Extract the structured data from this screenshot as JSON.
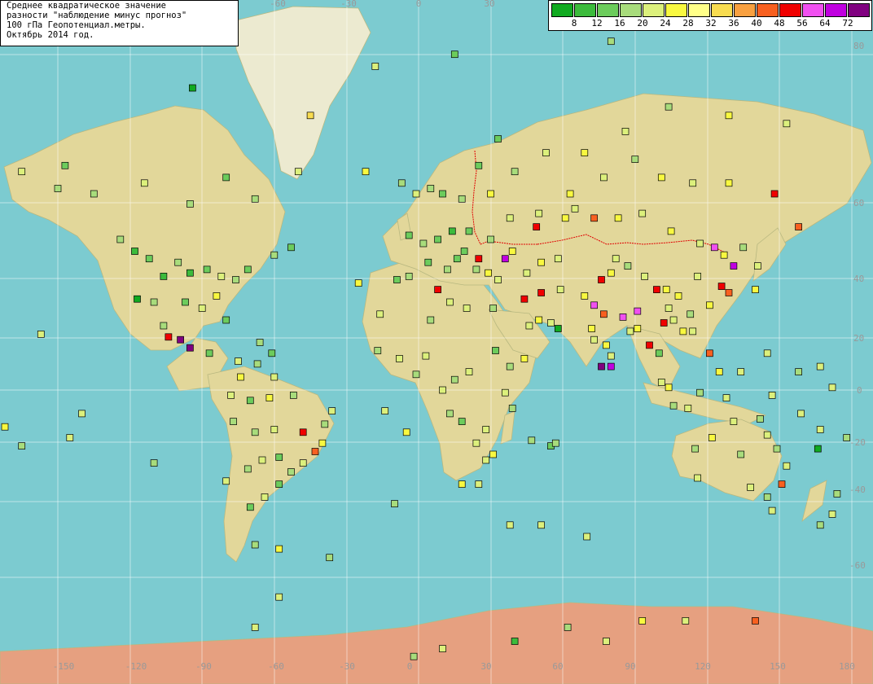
{
  "title": {
    "lines": [
      "Среднее квадратическое значение",
      "разности \"наблюдение минус прогноз\"",
      "100 гПа Геопотенциал.метры.",
      "Октябрь 2014 год."
    ]
  },
  "legend": {
    "colors": [
      "#10aa20",
      "#3cbb3c",
      "#6ccc5c",
      "#a8dc7c",
      "#dcf07c",
      "#f8f840",
      "#ffff88",
      "#f8dc50",
      "#f8a040",
      "#f86020",
      "#f00000",
      "#f050f0",
      "#c000e0",
      "#800080"
    ],
    "labels": [
      "8",
      "12",
      "16",
      "20",
      "24",
      "28",
      "32",
      "36",
      "40",
      "48",
      "56",
      "64",
      "72"
    ]
  },
  "axes": {
    "lon_labels": [
      "-150",
      "-120",
      "-90",
      "-60",
      "-30",
      "0",
      "30",
      "60",
      "90",
      "120",
      "150",
      "180"
    ],
    "lat_labels": [
      "80",
      "60",
      "40",
      "20",
      "0",
      "-20",
      "-40",
      "-60"
    ],
    "top_lon_labels": [
      "-60",
      "-30",
      "0",
      "30"
    ]
  },
  "stations": [
    {
      "lon": -124,
      "lat": 50,
      "c": 3
    },
    {
      "lon": -118,
      "lat": 47,
      "c": 1
    },
    {
      "lon": -112,
      "lat": 45,
      "c": 2
    },
    {
      "lon": -106,
      "lat": 40,
      "c": 1
    },
    {
      "lon": -100,
      "lat": 44,
      "c": 3
    },
    {
      "lon": -95,
      "lat": 41,
      "c": 1
    },
    {
      "lon": -88,
      "lat": 42,
      "c": 2
    },
    {
      "lon": -82,
      "lat": 40,
      "c": 4
    },
    {
      "lon": -76,
      "lat": 39,
      "c": 3
    },
    {
      "lon": -71,
      "lat": 42,
      "c": 2
    },
    {
      "lon": -90,
      "lat": 30,
      "c": 4
    },
    {
      "lon": -97,
      "lat": 32,
      "c": 2
    },
    {
      "lon": -84,
      "lat": 34,
      "c": 5
    },
    {
      "lon": -80,
      "lat": 26,
      "c": 2
    },
    {
      "lon": -110,
      "lat": 32,
      "c": 3
    },
    {
      "lon": -117,
      "lat": 33,
      "c": 0
    },
    {
      "lon": -104,
      "lat": 20,
      "c": 10
    },
    {
      "lon": -99,
      "lat": 19,
      "c": 13
    },
    {
      "lon": -95,
      "lat": 16,
      "c": 13
    },
    {
      "lon": -87,
      "lat": 14,
      "c": 2
    },
    {
      "lon": -106,
      "lat": 24,
      "c": 3
    },
    {
      "lon": -150,
      "lat": 61,
      "c": 3
    },
    {
      "lon": -165,
      "lat": 64,
      "c": 4
    },
    {
      "lon": -147,
      "lat": 65,
      "c": 2
    },
    {
      "lon": -135,
      "lat": 60,
      "c": 3
    },
    {
      "lon": -114,
      "lat": 62,
      "c": 4
    },
    {
      "lon": -95,
      "lat": 58,
      "c": 3
    },
    {
      "lon": -80,
      "lat": 63,
      "c": 2
    },
    {
      "lon": -68,
      "lat": 59,
      "c": 3
    },
    {
      "lon": -94,
      "lat": 75,
      "c": 0
    },
    {
      "lon": -62,
      "lat": 82,
      "c": 0
    },
    {
      "lon": -45,
      "lat": 72,
      "c": 7
    },
    {
      "lon": -50,
      "lat": 64,
      "c": 4
    },
    {
      "lon": -22,
      "lat": 64,
      "c": 5
    },
    {
      "lon": -18,
      "lat": 77,
      "c": 4
    },
    {
      "lon": -60,
      "lat": 46,
      "c": 3
    },
    {
      "lon": -53,
      "lat": 48,
      "c": 2
    },
    {
      "lon": -66,
      "lat": 18,
      "c": 3
    },
    {
      "lon": -61,
      "lat": 14,
      "c": 2
    },
    {
      "lon": -75,
      "lat": 11,
      "c": 4
    },
    {
      "lon": -74,
      "lat": 5,
      "c": 5
    },
    {
      "lon": -67,
      "lat": 10,
      "c": 3
    },
    {
      "lon": -60,
      "lat": 5,
      "c": 4
    },
    {
      "lon": -52,
      "lat": -2,
      "c": 3
    },
    {
      "lon": -62,
      "lat": -3,
      "c": 5
    },
    {
      "lon": -70,
      "lat": -4,
      "c": 2
    },
    {
      "lon": -78,
      "lat": -2,
      "c": 4
    },
    {
      "lon": -77,
      "lat": -12,
      "c": 3
    },
    {
      "lon": -68,
      "lat": -16,
      "c": 3
    },
    {
      "lon": -60,
      "lat": -15,
      "c": 4
    },
    {
      "lon": -48,
      "lat": -16,
      "c": 10
    },
    {
      "lon": -43,
      "lat": -23,
      "c": 9
    },
    {
      "lon": -39,
      "lat": -13,
      "c": 3
    },
    {
      "lon": -36,
      "lat": -8,
      "c": 4
    },
    {
      "lon": -58,
      "lat": -25,
      "c": 2
    },
    {
      "lon": -65,
      "lat": -26,
      "c": 4
    },
    {
      "lon": -71,
      "lat": -29,
      "c": 3
    },
    {
      "lon": -58,
      "lat": -34,
      "c": 2
    },
    {
      "lon": -64,
      "lat": -38,
      "c": 4
    },
    {
      "lon": -70,
      "lat": -41,
      "c": 2
    },
    {
      "lon": -68,
      "lat": -51,
      "c": 3
    },
    {
      "lon": -58,
      "lat": -52,
      "c": 5
    },
    {
      "lon": -48,
      "lat": -27,
      "c": 4
    },
    {
      "lon": -53,
      "lat": -30,
      "c": 3
    },
    {
      "lon": -40,
      "lat": -20,
      "c": 5
    },
    {
      "lon": -14,
      "lat": -8,
      "c": 4
    },
    {
      "lon": -5,
      "lat": -16,
      "c": 5
    },
    {
      "lon": -25,
      "lat": 38,
      "c": 5
    },
    {
      "lon": -16,
      "lat": 28,
      "c": 4
    },
    {
      "lon": -17,
      "lat": 15,
      "c": 3
    },
    {
      "lon": -8,
      "lat": 12,
      "c": 4
    },
    {
      "lon": -1,
      "lat": 6,
      "c": 3
    },
    {
      "lon": 3,
      "lat": 13,
      "c": 4
    },
    {
      "lon": 8,
      "lat": 36,
      "c": 10
    },
    {
      "lon": 13,
      "lat": 32,
      "c": 4
    },
    {
      "lon": 5,
      "lat": 26,
      "c": 3
    },
    {
      "lon": 20,
      "lat": 30,
      "c": 4
    },
    {
      "lon": 31,
      "lat": 30,
      "c": 3
    },
    {
      "lon": 32,
      "lat": 15,
      "c": 2
    },
    {
      "lon": 38,
      "lat": 9,
      "c": 3
    },
    {
      "lon": 36,
      "lat": -1,
      "c": 4
    },
    {
      "lon": 39,
      "lat": -7,
      "c": 3
    },
    {
      "lon": 28,
      "lat": -15,
      "c": 4
    },
    {
      "lon": 18,
      "lat": -12,
      "c": 2
    },
    {
      "lon": 13,
      "lat": -9,
      "c": 3
    },
    {
      "lon": 24,
      "lat": -20,
      "c": 4
    },
    {
      "lon": 31,
      "lat": -24,
      "c": 5
    },
    {
      "lon": 28,
      "lat": -26,
      "c": 4
    },
    {
      "lon": 18,
      "lat": -34,
      "c": 5
    },
    {
      "lon": 25,
      "lat": -34,
      "c": 4
    },
    {
      "lon": 47,
      "lat": -19,
      "c": 3
    },
    {
      "lon": 55,
      "lat": -21,
      "c": 2
    },
    {
      "lon": 57,
      "lat": -20,
      "c": 3
    },
    {
      "lon": 10,
      "lat": 0,
      "c": 4
    },
    {
      "lon": 15,
      "lat": 4,
      "c": 3
    },
    {
      "lon": 21,
      "lat": 7,
      "c": 4
    },
    {
      "lon": 44,
      "lat": 12,
      "c": 5
    },
    {
      "lon": 46,
      "lat": 24,
      "c": 4
    },
    {
      "lon": 50,
      "lat": 26,
      "c": 5
    },
    {
      "lon": 55,
      "lat": 25,
      "c": 4
    },
    {
      "lon": 58,
      "lat": 23,
      "c": 0
    },
    {
      "lon": 44,
      "lat": 33,
      "c": 10
    },
    {
      "lon": 51,
      "lat": 35,
      "c": 10
    },
    {
      "lon": 59,
      "lat": 36,
      "c": 4
    },
    {
      "lon": 69,
      "lat": 34,
      "c": 5
    },
    {
      "lon": 73,
      "lat": 31,
      "c": 11
    },
    {
      "lon": 77,
      "lat": 28,
      "c": 9
    },
    {
      "lon": 72,
      "lat": 23,
      "c": 5
    },
    {
      "lon": 73,
      "lat": 19,
      "c": 4
    },
    {
      "lon": 78,
      "lat": 17,
      "c": 5
    },
    {
      "lon": 80,
      "lat": 13,
      "c": 4
    },
    {
      "lon": 76,
      "lat": 9,
      "c": 13
    },
    {
      "lon": 80,
      "lat": 9,
      "c": 12
    },
    {
      "lon": 88,
      "lat": 22,
      "c": 4
    },
    {
      "lon": 85,
      "lat": 27,
      "c": 11
    },
    {
      "lon": 91,
      "lat": 23,
      "c": 5
    },
    {
      "lon": 96,
      "lat": 17,
      "c": 10
    },
    {
      "lon": 100,
      "lat": 14,
      "c": 2
    },
    {
      "lon": 101,
      "lat": 3,
      "c": 4
    },
    {
      "lon": 104,
      "lat": 1,
      "c": 5
    },
    {
      "lon": 106,
      "lat": -6,
      "c": 3
    },
    {
      "lon": 112,
      "lat": -7,
      "c": 4
    },
    {
      "lon": 117,
      "lat": -1,
      "c": 3
    },
    {
      "lon": 125,
      "lat": 7,
      "c": 5
    },
    {
      "lon": 121,
      "lat": 14,
      "c": 9
    },
    {
      "lon": 114,
      "lat": 22,
      "c": 4
    },
    {
      "lon": 113,
      "lat": 28,
      "c": 3
    },
    {
      "lon": 108,
      "lat": 34,
      "c": 5
    },
    {
      "lon": 116,
      "lat": 40,
      "c": 4
    },
    {
      "lon": 121,
      "lat": 31,
      "c": 5
    },
    {
      "lon": 126,
      "lat": 37,
      "c": 10
    },
    {
      "lon": 129,
      "lat": 35,
      "c": 9
    },
    {
      "lon": 140,
      "lat": 36,
      "c": 5
    },
    {
      "lon": 141,
      "lat": 43,
      "c": 4
    },
    {
      "lon": 131,
      "lat": 43,
      "c": 12
    },
    {
      "lon": 127,
      "lat": 46,
      "c": 5
    },
    {
      "lon": 123,
      "lat": 48,
      "c": 11
    },
    {
      "lon": 117,
      "lat": 49,
      "c": 4
    },
    {
      "lon": 105,
      "lat": 52,
      "c": 5
    },
    {
      "lon": 93,
      "lat": 56,
      "c": 4
    },
    {
      "lon": 83,
      "lat": 55,
      "c": 5
    },
    {
      "lon": 73,
      "lat": 55,
      "c": 9
    },
    {
      "lon": 65,
      "lat": 57,
      "c": 4
    },
    {
      "lon": 61,
      "lat": 55,
      "c": 5
    },
    {
      "lon": 50,
      "lat": 56,
      "c": 4
    },
    {
      "lon": 49,
      "lat": 53,
      "c": 10
    },
    {
      "lon": 38,
      "lat": 55,
      "c": 4
    },
    {
      "lon": 30,
      "lat": 60,
      "c": 5
    },
    {
      "lon": 40,
      "lat": 64,
      "c": 3
    },
    {
      "lon": 33,
      "lat": 69,
      "c": 2
    },
    {
      "lon": 53,
      "lat": 67,
      "c": 4
    },
    {
      "lon": 69,
      "lat": 67,
      "c": 5
    },
    {
      "lon": 86,
      "lat": 70,
      "c": 4
    },
    {
      "lon": 104,
      "lat": 73,
      "c": 3
    },
    {
      "lon": 129,
      "lat": 72,
      "c": 5
    },
    {
      "lon": 153,
      "lat": 71,
      "c": 4
    },
    {
      "lon": 148,
      "lat": 60,
      "c": 10
    },
    {
      "lon": 158,
      "lat": 53,
      "c": 9
    },
    {
      "lon": 135,
      "lat": 48,
      "c": 3
    },
    {
      "lon": 129,
      "lat": 62,
      "c": 5
    },
    {
      "lon": 114,
      "lat": 62,
      "c": 4
    },
    {
      "lon": 101,
      "lat": 63,
      "c": 5
    },
    {
      "lon": 90,
      "lat": 66,
      "c": 3
    },
    {
      "lon": 77,
      "lat": 63,
      "c": 4
    },
    {
      "lon": 63,
      "lat": 60,
      "c": 5
    },
    {
      "lon": 82,
      "lat": 45,
      "c": 4
    },
    {
      "lon": 87,
      "lat": 43,
      "c": 3
    },
    {
      "lon": 76,
      "lat": 39,
      "c": 10
    },
    {
      "lon": 80,
      "lat": 41,
      "c": 5
    },
    {
      "lon": 94,
      "lat": 40,
      "c": 4
    },
    {
      "lon": 99,
      "lat": 36,
      "c": 10
    },
    {
      "lon": 103,
      "lat": 36,
      "c": 5
    },
    {
      "lon": 91,
      "lat": 29,
      "c": 11
    },
    {
      "lon": 104,
      "lat": 30,
      "c": 4
    },
    {
      "lon": 110,
      "lat": 22,
      "c": 5
    },
    {
      "lon": 106,
      "lat": 26,
      "c": 4
    },
    {
      "lon": 102,
      "lat": 25,
      "c": 10
    },
    {
      "lon": 58,
      "lat": 45,
      "c": 4
    },
    {
      "lon": 51,
      "lat": 44,
      "c": 5
    },
    {
      "lon": 45,
      "lat": 41,
      "c": 4
    },
    {
      "lon": 39,
      "lat": 47,
      "c": 5
    },
    {
      "lon": 30,
      "lat": 50,
      "c": 3
    },
    {
      "lon": 21,
      "lat": 52,
      "c": 2
    },
    {
      "lon": 14,
      "lat": 52,
      "c": 1
    },
    {
      "lon": 8,
      "lat": 50,
      "c": 2
    },
    {
      "lon": 2,
      "lat": 49,
      "c": 3
    },
    {
      "lon": -4,
      "lat": 51,
      "c": 2
    },
    {
      "lon": -9,
      "lat": 39,
      "c": 2
    },
    {
      "lon": -4,
      "lat": 40,
      "c": 3
    },
    {
      "lon": 4,
      "lat": 44,
      "c": 2
    },
    {
      "lon": 12,
      "lat": 42,
      "c": 3
    },
    {
      "lon": 16,
      "lat": 45,
      "c": 2
    },
    {
      "lon": 24,
      "lat": 42,
      "c": 3
    },
    {
      "lon": 29,
      "lat": 41,
      "c": 5
    },
    {
      "lon": 33,
      "lat": 39,
      "c": 4
    },
    {
      "lon": 36,
      "lat": 45,
      "c": 12
    },
    {
      "lon": 25,
      "lat": 45,
      "c": 10
    },
    {
      "lon": 19,
      "lat": 47,
      "c": 2
    },
    {
      "lon": 10,
      "lat": 60,
      "c": 2
    },
    {
      "lon": 18,
      "lat": 59,
      "c": 3
    },
    {
      "lon": 25,
      "lat": 65,
      "c": 2
    },
    {
      "lon": 5,
      "lat": 61,
      "c": 3
    },
    {
      "lon": -1,
      "lat": 60,
      "c": 4
    },
    {
      "lon": -7,
      "lat": 62,
      "c": 3
    },
    {
      "lon": 15,
      "lat": 78,
      "c": 2
    },
    {
      "lon": 58,
      "lat": 81,
      "c": 11
    },
    {
      "lon": 80,
      "lat": 79,
      "c": 3
    },
    {
      "lon": 128,
      "lat": -3,
      "c": 4
    },
    {
      "lon": 131,
      "lat": -12,
      "c": 4
    },
    {
      "lon": 142,
      "lat": -11,
      "c": 3
    },
    {
      "lon": 145,
      "lat": -17,
      "c": 4
    },
    {
      "lon": 149,
      "lat": -22,
      "c": 3
    },
    {
      "lon": 153,
      "lat": -28,
      "c": 4
    },
    {
      "lon": 151,
      "lat": -34,
      "c": 9
    },
    {
      "lon": 145,
      "lat": -38,
      "c": 3
    },
    {
      "lon": 138,
      "lat": -35,
      "c": 4
    },
    {
      "lon": 134,
      "lat": -24,
      "c": 3
    },
    {
      "lon": 122,
      "lat": -18,
      "c": 5
    },
    {
      "lon": 116,
      "lat": -32,
      "c": 4
    },
    {
      "lon": 115,
      "lat": -22,
      "c": 3
    },
    {
      "lon": 147,
      "lat": -42,
      "c": 4
    },
    {
      "lon": 174,
      "lat": -37,
      "c": 3
    },
    {
      "lon": 172,
      "lat": -43,
      "c": 4
    },
    {
      "lon": 167,
      "lat": -46,
      "c": 3
    },
    {
      "lon": 159,
      "lat": -9,
      "c": 4
    },
    {
      "lon": 167,
      "lat": -15,
      "c": 4
    },
    {
      "lon": 178,
      "lat": -18,
      "c": 3
    },
    {
      "lon": 166,
      "lat": -22,
      "c": 0
    },
    {
      "lon": 172,
      "lat": 1,
      "c": 4
    },
    {
      "lon": 147,
      "lat": -2,
      "c": 4
    },
    {
      "lon": 158,
      "lat": 7,
      "c": 3
    },
    {
      "lon": 167,
      "lat": 9,
      "c": 4
    },
    {
      "lon": 145,
      "lat": 14,
      "c": 4
    },
    {
      "lon": 134,
      "lat": 7,
      "c": 4
    },
    {
      "lon": -157,
      "lat": 21,
      "c": 4
    },
    {
      "lon": -145,
      "lat": -18,
      "c": 4
    },
    {
      "lon": -172,
      "lat": -14,
      "c": 5
    },
    {
      "lon": -178,
      "lat": -18,
      "c": 3
    },
    {
      "lon": -165,
      "lat": -21,
      "c": 3
    },
    {
      "lon": -140,
      "lat": -9,
      "c": 4
    },
    {
      "lon": -110,
      "lat": -27,
      "c": 3
    },
    {
      "lon": -80,
      "lat": -33,
      "c": 4
    },
    {
      "lon": -58,
      "lat": -62,
      "c": 4
    },
    {
      "lon": -68,
      "lat": -67,
      "c": 4
    },
    {
      "lon": -26,
      "lat": -75,
      "c": 4
    },
    {
      "lon": -2,
      "lat": -71,
      "c": 3
    },
    {
      "lon": 40,
      "lat": -69,
      "c": 1
    },
    {
      "lon": 62,
      "lat": -67,
      "c": 3
    },
    {
      "lon": 78,
      "lat": -69,
      "c": 4
    },
    {
      "lon": 93,
      "lat": -66,
      "c": 5
    },
    {
      "lon": 111,
      "lat": -66,
      "c": 4
    },
    {
      "lon": 140,
      "lat": -66,
      "c": 9
    },
    {
      "lon": 166,
      "lat": -77,
      "c": 3
    },
    {
      "lon": 10,
      "lat": -70,
      "c": 4
    },
    {
      "lon": 0,
      "lat": -90,
      "c": 10
    },
    {
      "lon": 70,
      "lat": -49,
      "c": 4
    },
    {
      "lon": 51,
      "lat": -46,
      "c": 4
    },
    {
      "lon": -10,
      "lat": -40,
      "c": 3
    },
    {
      "lon": 38,
      "lat": -46,
      "c": 4
    },
    {
      "lon": -37,
      "lat": -54,
      "c": 3
    }
  ]
}
